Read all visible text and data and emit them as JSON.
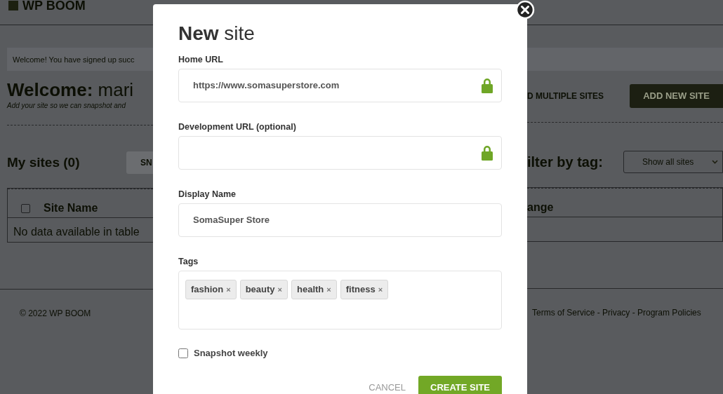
{
  "background": {
    "logo": "WP BOOM",
    "alert": "Welcome! You have signed up succ",
    "heading": "**Welcome:** mari",
    "subtitle": "Add your site so we can snapshot and",
    "sites_heading": "My sites (0)",
    "snapshot_button": "SN",
    "bulk_link": "D MULTIPLE SITES",
    "add_button": "ADD NEW SITE",
    "filter_label": "ilter by tag:",
    "filter_select": "Show all sites",
    "table": {
      "select_all_checked": false,
      "columns": [
        {
          "label": "Site Name"
        },
        {
          "label": "ange"
        }
      ],
      "empty_message": "No data available in table"
    },
    "footer_copyright": "© 2022 WP BOOM",
    "footer_links": "Terms of Service - Privacy - Program Policies"
  },
  "modal": {
    "title": "**New** site",
    "fields": [
      {
        "kind": "url",
        "label": "Home URL",
        "value": "https://www.somasuperstore.com"
      },
      {
        "kind": "url",
        "label": "Development URL (optional)"
      },
      {
        "kind": "text",
        "label": "Display Name",
        "value": "SomaSuper Store"
      },
      {
        "kind": "tags",
        "label": "Tags",
        "tags": [
          {
            "label": "fashion",
            "remove": "×"
          },
          {
            "label": "beauty",
            "remove": "×"
          },
          {
            "label": "health",
            "remove": "×"
          },
          {
            "label": "fitness",
            "remove": "×"
          }
        ]
      }
    ],
    "snapshot_weekly": {
      "label": "Snapshot weekly",
      "checked": false
    },
    "cancel_button": "CANCEL",
    "create_button": "CREATE SITE"
  }
}
